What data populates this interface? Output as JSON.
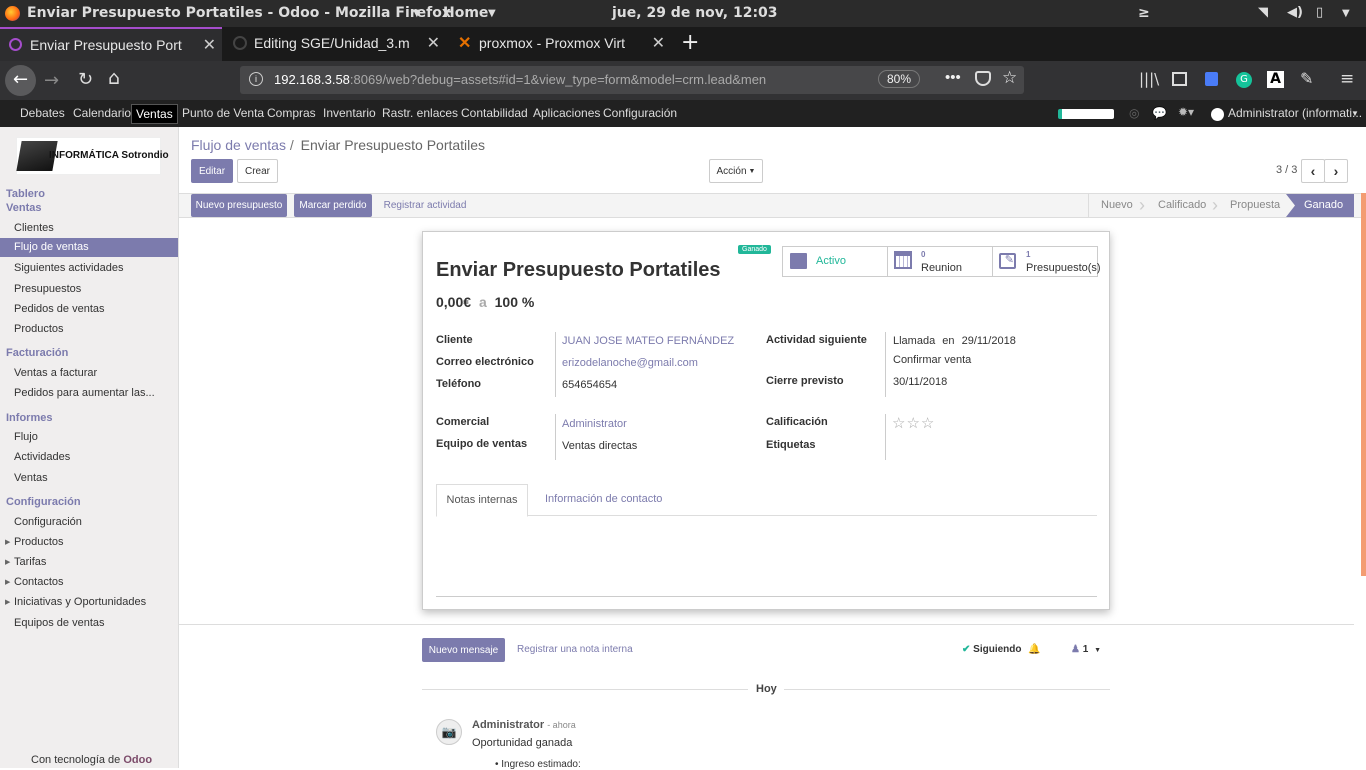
{
  "os_bar": {
    "window_title": "Enviar Presupuesto Portatiles - Odoo - Mozilla Firefox",
    "home_menu": "Home",
    "clock": "jue, 29 de nov, 12:03"
  },
  "browser": {
    "tabs": [
      {
        "title": "Enviar Presupuesto Port",
        "active": true
      },
      {
        "title": "Editing SGE/Unidad_3.m",
        "active": false
      },
      {
        "title": "proxmox - Proxmox Virt",
        "active": false
      }
    ],
    "url_host": "192.168.3.58",
    "url_rest": ":8069/web?debug=assets#id=1&view_type=form&model=crm.lead&men",
    "zoom": "80%"
  },
  "odoo_menu": {
    "items": [
      "Debates",
      "Calendario",
      "Ventas",
      "Punto de Venta",
      "Compras",
      "Inventario",
      "Rastr. enlaces",
      "Contabilidad",
      "Aplicaciones",
      "Configuración"
    ],
    "active": "Ventas",
    "user": "Administrator (informati..."
  },
  "sidebar": {
    "company_logo_text": "INFORMÁTICA Sotrondio",
    "sections": [
      {
        "title": "Tablero",
        "items": []
      },
      {
        "title": "Ventas",
        "items": [
          "Clientes",
          "Flujo de ventas",
          "Siguientes actividades",
          "Presupuestos",
          "Pedidos de ventas",
          "Productos"
        ]
      },
      {
        "title": "Facturación",
        "items": [
          "Ventas a facturar",
          "Pedidos para aumentar las..."
        ]
      },
      {
        "title": "Informes",
        "items": [
          "Flujo",
          "Actividades",
          "Ventas"
        ]
      },
      {
        "title": "Configuración",
        "items": [
          "Configuración",
          "Productos",
          "Tarifas",
          "Contactos",
          "Iniciativas y Oportunidades",
          "Equipos de ventas"
        ]
      }
    ],
    "selected": "Flujo de ventas",
    "footer_prefix": "Con tecnología de",
    "footer_brand": "Odoo"
  },
  "control_panel": {
    "breadcrumb_parent": "Flujo de ventas",
    "breadcrumb_sep": "/",
    "breadcrumb_current": "Enviar Presupuesto Portatiles",
    "edit_label": "Editar",
    "create_label": "Crear",
    "action_label": "Acción",
    "pager": "3 / 3"
  },
  "statusbar": {
    "buttons": [
      "Nuevo presupuesto",
      "Marcar perdido",
      "Registrar actividad"
    ],
    "stages": [
      "Nuevo",
      "Calificado",
      "Propuesta",
      "Ganado"
    ],
    "current_stage": "Ganado"
  },
  "record": {
    "ribbon": "Ganado",
    "title": "Enviar Presupuesto Portatiles",
    "revenue": "0,00€",
    "revenue_sep": "a",
    "probability": "100 %",
    "smart_buttons": {
      "active": "Activo",
      "meetings_count": "0",
      "meetings_label": "Reunion",
      "quotes_count": "1",
      "quotes_label": "Presupuesto(s)"
    },
    "fields": {
      "cliente_label": "Cliente",
      "cliente_value": "JUAN JOSE MATEO FERNÁNDEZ",
      "correo_label": "Correo electrónico",
      "correo_value": "erizodelanoche@gmail.com",
      "telefono_label": "Teléfono",
      "telefono_value": "654654654",
      "actividad_label": "Actividad siguiente",
      "actividad_type": "Llamada",
      "actividad_en": "en",
      "actividad_date": "29/11/2018",
      "actividad_summary": "Confirmar venta",
      "cierre_label": "Cierre previsto",
      "cierre_value": "30/11/2018",
      "comercial_label": "Comercial",
      "comercial_value": "Administrator",
      "equipo_label": "Equipo de ventas",
      "equipo_value": "Ventas directas",
      "calificacion_label": "Calificación",
      "calificacion_stars": 0,
      "etiquetas_label": "Etiquetas"
    },
    "notebook_tabs": [
      "Notas internas",
      "Información de contacto"
    ],
    "active_tab": "Notas internas"
  },
  "chatter": {
    "new_message": "Nuevo mensaje",
    "log_note": "Registrar una nota interna",
    "following": "Siguiendo",
    "followers_count": "1",
    "date_separator": "Hoy",
    "message": {
      "author": "Administrator",
      "time": "- ahora",
      "body": "Oportunidad ganada",
      "bullet": "Ingreso estimado:"
    }
  }
}
